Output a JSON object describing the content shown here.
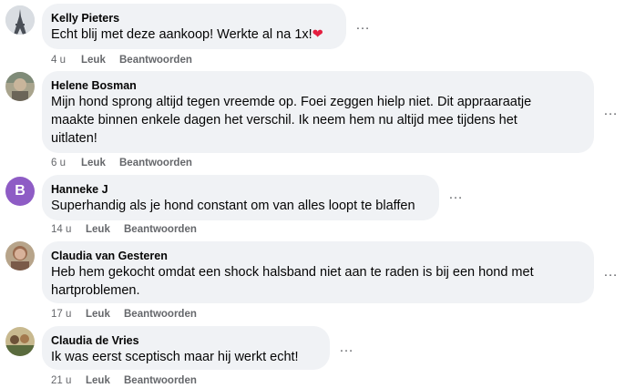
{
  "comments": [
    {
      "author": "Kelly Pieters",
      "text": "Echt blij met deze aankoop! Werkte al na 1x!",
      "emoji": "❤",
      "time": "4 u",
      "like": "Leuk",
      "reply": "Beantwoorden",
      "avatar_icon": "eiffel-tower-photo-icon"
    },
    {
      "author": "Helene Bosman",
      "text_lines": [
        "Mijn hond sprong altijd tegen vreemde op. Foei zeggen hielp niet. Dit appraaraatje",
        "maakte binnen enkele dagen het verschil. Ik neem hem nu altijd mee tijdens het",
        "uitlaten!"
      ],
      "time": "6 u",
      "like": "Leuk",
      "reply": "Beantwoorden",
      "avatar_icon": "portrait-photo-icon"
    },
    {
      "author": "Hanneke J",
      "text": "Superhandig als je hond constant om van alles loopt te blaffen",
      "time": "14 u",
      "like": "Leuk",
      "reply": "Beantwoorden",
      "avatar_letter": "B",
      "avatar_color": "#8e5cc5"
    },
    {
      "author": "Claudia van Gesteren",
      "text_lines": [
        "Heb hem gekocht omdat een shock halsband niet aan te raden is bij een hond met",
        "hartproblemen."
      ],
      "time": "17 u",
      "like": "Leuk",
      "reply": "Beantwoorden",
      "avatar_icon": "portrait-photo-icon"
    },
    {
      "author": "Claudia de Vries",
      "text": "Ik was eerst sceptisch maar hij werkt echt!",
      "time": "21 u",
      "like": "Leuk",
      "reply": "Beantwoorden",
      "avatar_icon": "group-photo-icon"
    }
  ],
  "more_icon": "…"
}
